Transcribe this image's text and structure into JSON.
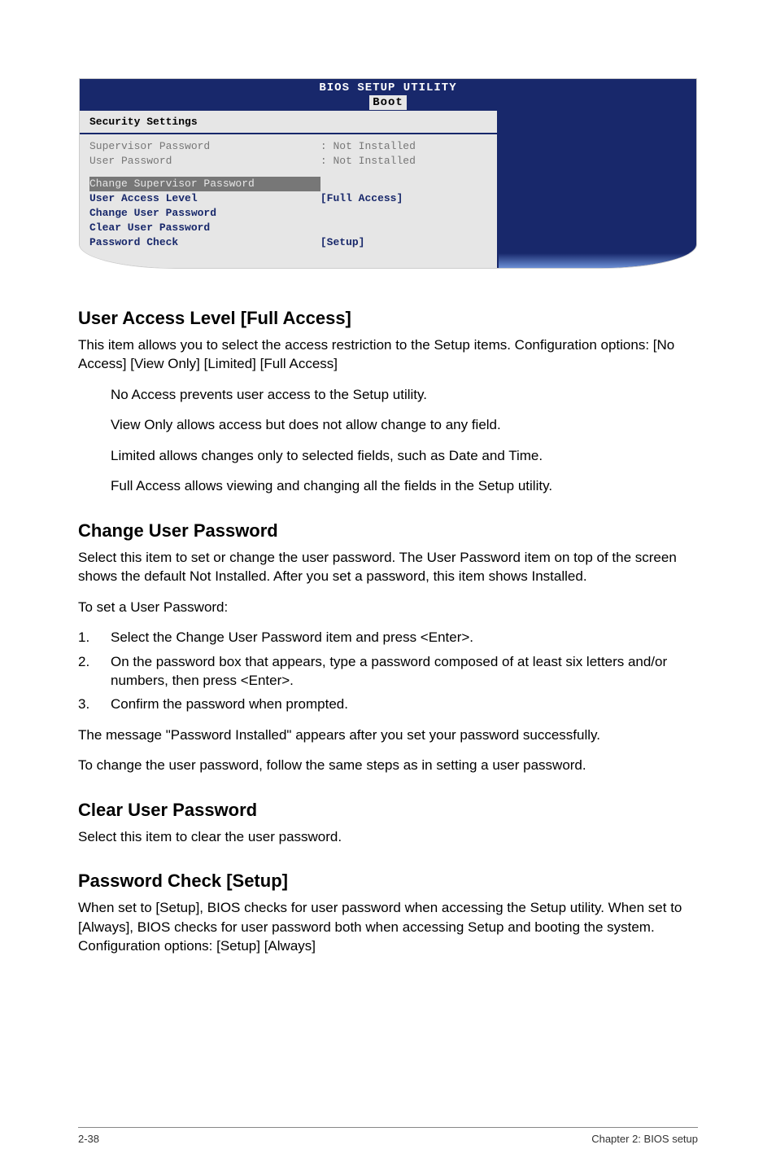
{
  "bios": {
    "title_line1": "BIOS SETUP UTILITY",
    "menu": "Boot",
    "section_header": "Security Settings",
    "rows": {
      "sup_pw_label": "Supervisor Password",
      "sup_pw_value": ": Not Installed",
      "usr_pw_label": "User Password",
      "usr_pw_value": ": Not Installed",
      "change_sup": "Change Supervisor Password",
      "user_access_label": "User Access Level",
      "user_access_value": "[Full Access]",
      "change_user": "Change User Password",
      "clear_user": "Clear User Password",
      "pw_check_label": "Password Check",
      "pw_check_value": "[Setup]"
    }
  },
  "sections": {
    "ual": {
      "heading": "User Access Level [Full Access]",
      "p1": "This item allows you to select the access restriction to the Setup items. Configuration options: [No Access] [View Only] [Limited] [Full Access]",
      "bullets": {
        "b1": "No Access prevents user access to the Setup utility.",
        "b2": "View Only allows access but does not allow change to any field.",
        "b3": "Limited allows changes only to selected fields, such as Date and Time.",
        "b4": "Full Access allows viewing and changing all the fields in the Setup utility."
      }
    },
    "cup": {
      "heading": "Change User Password",
      "p1": "Select this item to set or change the user password. The User Password item on top of the screen shows the default Not Installed. After you set a password, this item shows Installed.",
      "p2": "To set a User Password:",
      "steps": {
        "s1": "Select the Change User Password item and press <Enter>.",
        "s2": "On the password box that appears, type a password composed of at least six letters and/or numbers, then press <Enter>.",
        "s3": "Confirm the password when prompted."
      },
      "p3": "The message \"Password Installed\" appears after you set your password successfully.",
      "p4": "To change the user password, follow the same steps as in setting a user password."
    },
    "clup": {
      "heading": "Clear User Password",
      "p1": "Select this item to clear the user password."
    },
    "pwc": {
      "heading": "Password Check [Setup]",
      "p1": "When set to [Setup], BIOS checks for user password when accessing the Setup utility. When set to [Always], BIOS checks for user password both when accessing Setup and booting the system. Configuration options: [Setup] [Always]"
    }
  },
  "footer": {
    "left": "2-38",
    "right": "Chapter 2: BIOS setup"
  }
}
